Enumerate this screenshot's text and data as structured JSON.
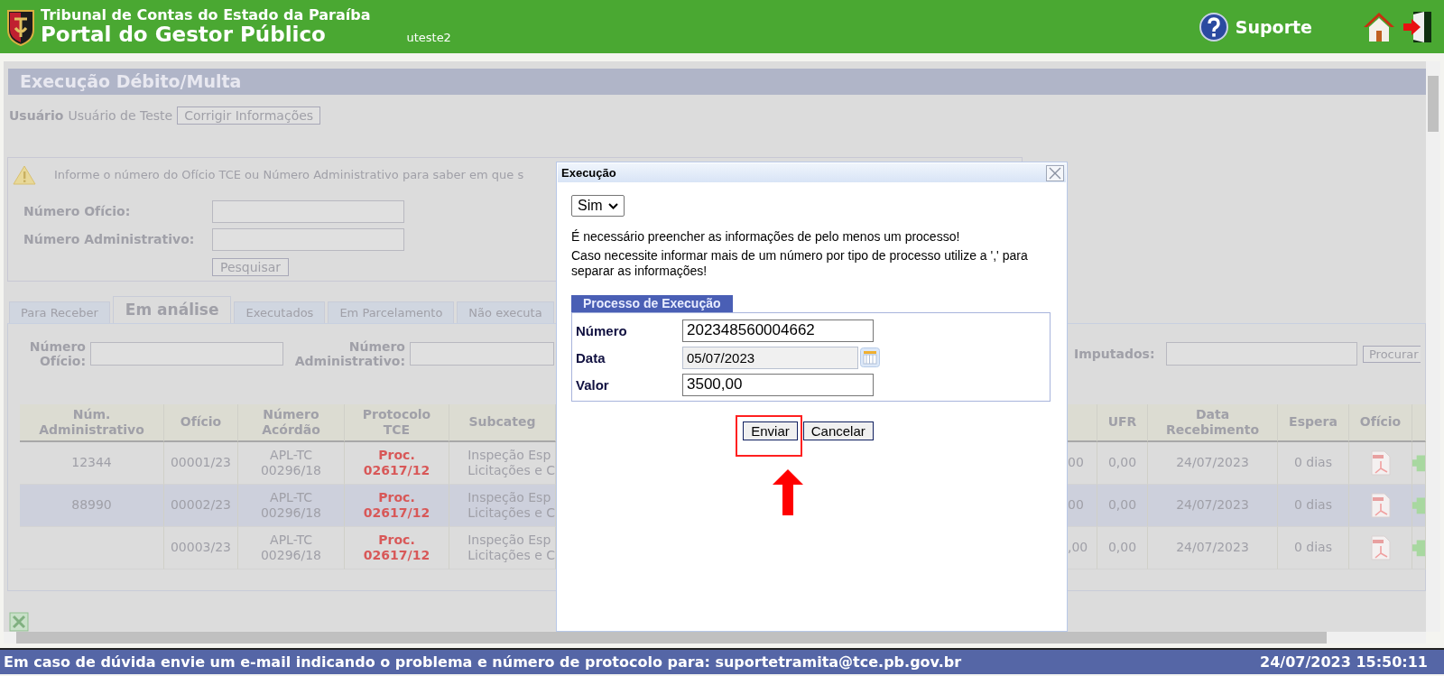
{
  "header": {
    "org": "Tribunal de Contas do Estado da Paraíba",
    "portal": "Portal do Gestor Público",
    "user": "uteste2",
    "support": "Suporte"
  },
  "page": {
    "title": "Execução Débito/Multa",
    "user_label": "Usuário",
    "user_name": "Usuário de Teste",
    "edit_button": "Corrigir Informações"
  },
  "search_box": {
    "message": "Informe o número do Ofício TCE ou Número Administrativo para saber em que s",
    "fields": [
      {
        "label": "Número Ofício:"
      },
      {
        "label": "Número Administrativo:"
      }
    ],
    "button": "Pesquisar"
  },
  "tabs": [
    {
      "label": "Para Receber",
      "selected": false
    },
    {
      "label": "Em análise",
      "selected": true
    },
    {
      "label": "Executados",
      "selected": false
    },
    {
      "label": "Em Parcelamento",
      "selected": false
    },
    {
      "label": "Não executa",
      "selected": false
    }
  ],
  "filters": {
    "fields": [
      {
        "label": "Número Ofício:"
      },
      {
        "label": "Número Administrativo:"
      },
      {
        "label": "Imputados:"
      }
    ],
    "button": "Procurar"
  },
  "table": {
    "columns": [
      [
        "Núm.",
        "Administrativo"
      ],
      [
        "Ofício"
      ],
      [
        "Número",
        "Acórdão"
      ],
      [
        "Protocolo",
        "TCE"
      ],
      [
        "Subcateg"
      ]
    ],
    "right_columns": [
      [
        "UFR"
      ],
      [
        "Data",
        "Recebimento"
      ],
      [
        "Espera"
      ],
      [
        "Ofício"
      ]
    ],
    "rows": [
      {
        "selected": false,
        "admin": "12344",
        "oficio": "00001/23",
        "acordao": [
          "APL-TC",
          "00296/18"
        ],
        "protocolo": [
          "Proc.",
          "02617/12"
        ],
        "subcategoria": [
          "Inspeção Esp",
          "Licitações e C"
        ],
        "cut": "00",
        "ufr": "0,00",
        "recebimento": "24/07/2023",
        "espera": "0 dias"
      },
      {
        "selected": true,
        "admin": "88990",
        "oficio": "00002/23",
        "acordao": [
          "APL-TC",
          "00296/18"
        ],
        "protocolo": [
          "Proc.",
          "02617/12"
        ],
        "subcategoria": [
          "Inspeção Esp",
          "Licitações e C"
        ],
        "cut": "00",
        "ufr": "0,00",
        "recebimento": "24/07/2023",
        "espera": "0 dias"
      },
      {
        "selected": false,
        "oficio": "00003/23",
        "acordao": [
          "APL-TC",
          "00296/18"
        ],
        "protocolo": [
          "Proc.",
          "02617/12"
        ],
        "subcategoria": [
          "Inspeção Esp",
          "Licitações e C"
        ],
        "cut": ",00",
        "ufr": "0,00",
        "recebimento": "24/07/2023",
        "espera": "0 dias"
      }
    ]
  },
  "dialog": {
    "title": "Execução",
    "select_value": "Sim",
    "messages": [
      "É necessário preencher as informações de pelo menos um processo!",
      "Caso necessite informar mais de um número por tipo de processo utilize a ',' para separar as informações!"
    ],
    "legend": "Processo de Execução",
    "fields": [
      {
        "label": "Número",
        "value": "202348560004662",
        "kind": "text"
      },
      {
        "label": "Data",
        "value": "05/07/2023",
        "kind": "date"
      },
      {
        "label": "Valor",
        "value": "3500,00",
        "kind": "text"
      }
    ],
    "buttons": [
      {
        "label": "Enviar",
        "highlighted": true
      },
      {
        "label": "Cancelar",
        "highlighted": false
      }
    ]
  },
  "status_bar": {
    "message": "Em caso de dúvida envie um e-mail indicando o problema e número de protocolo para: suportetramita@tce.pb.gov.br",
    "datetime": "24/07/2023 15:50:11"
  }
}
